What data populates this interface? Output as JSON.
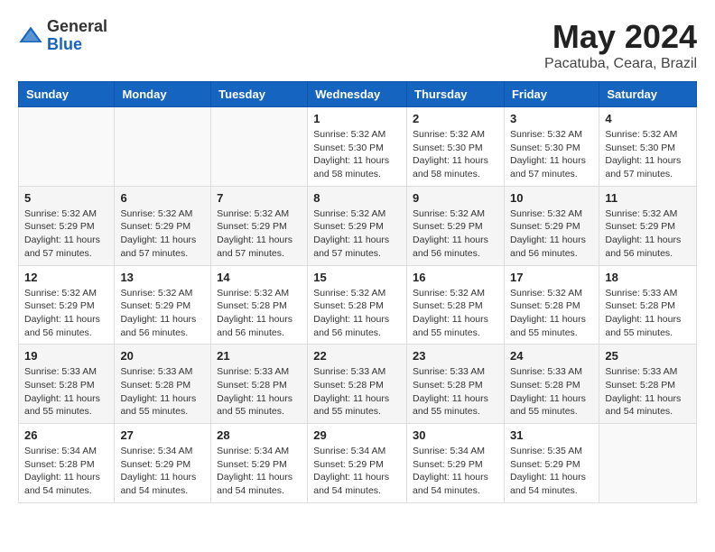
{
  "header": {
    "logo_general": "General",
    "logo_blue": "Blue",
    "month_year": "May 2024",
    "location": "Pacatuba, Ceara, Brazil"
  },
  "weekdays": [
    "Sunday",
    "Monday",
    "Tuesday",
    "Wednesday",
    "Thursday",
    "Friday",
    "Saturday"
  ],
  "weeks": [
    [
      {
        "day": "",
        "text": ""
      },
      {
        "day": "",
        "text": ""
      },
      {
        "day": "",
        "text": ""
      },
      {
        "day": "1",
        "text": "Sunrise: 5:32 AM\nSunset: 5:30 PM\nDaylight: 11 hours\nand 58 minutes."
      },
      {
        "day": "2",
        "text": "Sunrise: 5:32 AM\nSunset: 5:30 PM\nDaylight: 11 hours\nand 58 minutes."
      },
      {
        "day": "3",
        "text": "Sunrise: 5:32 AM\nSunset: 5:30 PM\nDaylight: 11 hours\nand 57 minutes."
      },
      {
        "day": "4",
        "text": "Sunrise: 5:32 AM\nSunset: 5:30 PM\nDaylight: 11 hours\nand 57 minutes."
      }
    ],
    [
      {
        "day": "5",
        "text": "Sunrise: 5:32 AM\nSunset: 5:29 PM\nDaylight: 11 hours\nand 57 minutes."
      },
      {
        "day": "6",
        "text": "Sunrise: 5:32 AM\nSunset: 5:29 PM\nDaylight: 11 hours\nand 57 minutes."
      },
      {
        "day": "7",
        "text": "Sunrise: 5:32 AM\nSunset: 5:29 PM\nDaylight: 11 hours\nand 57 minutes."
      },
      {
        "day": "8",
        "text": "Sunrise: 5:32 AM\nSunset: 5:29 PM\nDaylight: 11 hours\nand 57 minutes."
      },
      {
        "day": "9",
        "text": "Sunrise: 5:32 AM\nSunset: 5:29 PM\nDaylight: 11 hours\nand 56 minutes."
      },
      {
        "day": "10",
        "text": "Sunrise: 5:32 AM\nSunset: 5:29 PM\nDaylight: 11 hours\nand 56 minutes."
      },
      {
        "day": "11",
        "text": "Sunrise: 5:32 AM\nSunset: 5:29 PM\nDaylight: 11 hours\nand 56 minutes."
      }
    ],
    [
      {
        "day": "12",
        "text": "Sunrise: 5:32 AM\nSunset: 5:29 PM\nDaylight: 11 hours\nand 56 minutes."
      },
      {
        "day": "13",
        "text": "Sunrise: 5:32 AM\nSunset: 5:29 PM\nDaylight: 11 hours\nand 56 minutes."
      },
      {
        "day": "14",
        "text": "Sunrise: 5:32 AM\nSunset: 5:28 PM\nDaylight: 11 hours\nand 56 minutes."
      },
      {
        "day": "15",
        "text": "Sunrise: 5:32 AM\nSunset: 5:28 PM\nDaylight: 11 hours\nand 56 minutes."
      },
      {
        "day": "16",
        "text": "Sunrise: 5:32 AM\nSunset: 5:28 PM\nDaylight: 11 hours\nand 55 minutes."
      },
      {
        "day": "17",
        "text": "Sunrise: 5:32 AM\nSunset: 5:28 PM\nDaylight: 11 hours\nand 55 minutes."
      },
      {
        "day": "18",
        "text": "Sunrise: 5:33 AM\nSunset: 5:28 PM\nDaylight: 11 hours\nand 55 minutes."
      }
    ],
    [
      {
        "day": "19",
        "text": "Sunrise: 5:33 AM\nSunset: 5:28 PM\nDaylight: 11 hours\nand 55 minutes."
      },
      {
        "day": "20",
        "text": "Sunrise: 5:33 AM\nSunset: 5:28 PM\nDaylight: 11 hours\nand 55 minutes."
      },
      {
        "day": "21",
        "text": "Sunrise: 5:33 AM\nSunset: 5:28 PM\nDaylight: 11 hours\nand 55 minutes."
      },
      {
        "day": "22",
        "text": "Sunrise: 5:33 AM\nSunset: 5:28 PM\nDaylight: 11 hours\nand 55 minutes."
      },
      {
        "day": "23",
        "text": "Sunrise: 5:33 AM\nSunset: 5:28 PM\nDaylight: 11 hours\nand 55 minutes."
      },
      {
        "day": "24",
        "text": "Sunrise: 5:33 AM\nSunset: 5:28 PM\nDaylight: 11 hours\nand 55 minutes."
      },
      {
        "day": "25",
        "text": "Sunrise: 5:33 AM\nSunset: 5:28 PM\nDaylight: 11 hours\nand 54 minutes."
      }
    ],
    [
      {
        "day": "26",
        "text": "Sunrise: 5:34 AM\nSunset: 5:28 PM\nDaylight: 11 hours\nand 54 minutes."
      },
      {
        "day": "27",
        "text": "Sunrise: 5:34 AM\nSunset: 5:29 PM\nDaylight: 11 hours\nand 54 minutes."
      },
      {
        "day": "28",
        "text": "Sunrise: 5:34 AM\nSunset: 5:29 PM\nDaylight: 11 hours\nand 54 minutes."
      },
      {
        "day": "29",
        "text": "Sunrise: 5:34 AM\nSunset: 5:29 PM\nDaylight: 11 hours\nand 54 minutes."
      },
      {
        "day": "30",
        "text": "Sunrise: 5:34 AM\nSunset: 5:29 PM\nDaylight: 11 hours\nand 54 minutes."
      },
      {
        "day": "31",
        "text": "Sunrise: 5:35 AM\nSunset: 5:29 PM\nDaylight: 11 hours\nand 54 minutes."
      },
      {
        "day": "",
        "text": ""
      }
    ]
  ]
}
